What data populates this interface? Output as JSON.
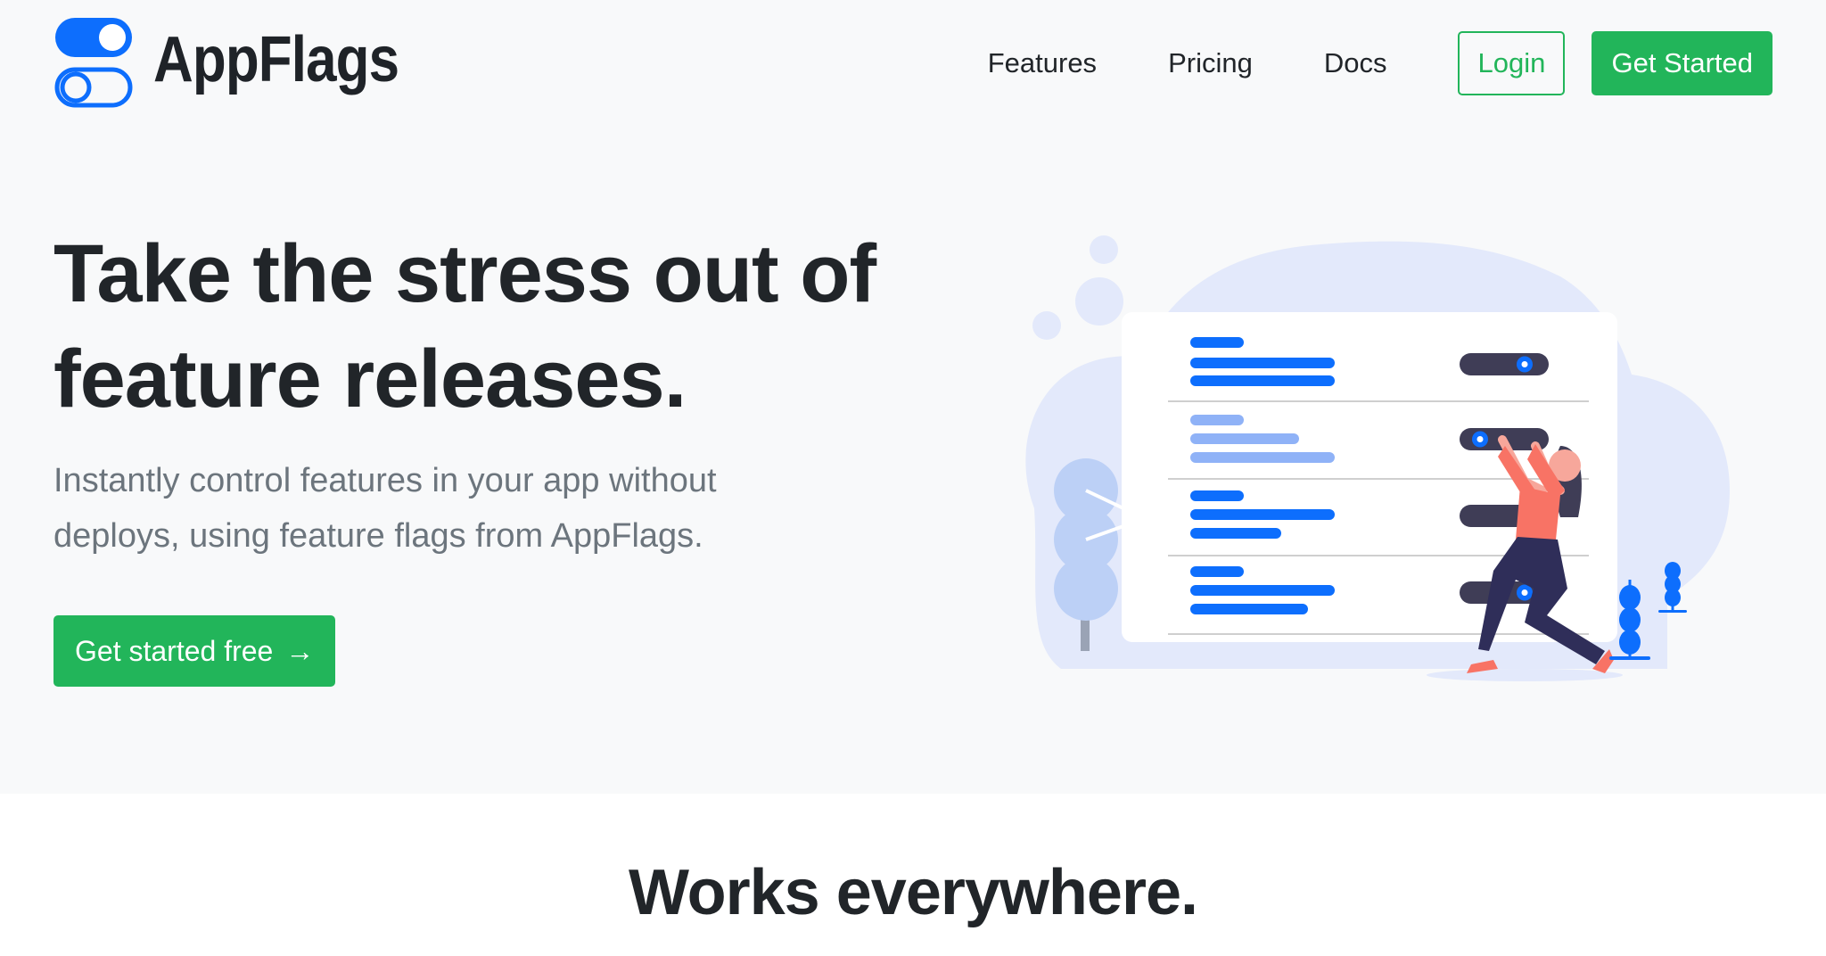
{
  "brand": {
    "name": "AppFlags",
    "logo_icon": "toggle-switches-icon",
    "accent_color": "#0d6efd"
  },
  "nav": {
    "links": [
      "Features",
      "Pricing",
      "Docs"
    ],
    "login_label": "Login",
    "get_started_label": "Get Started"
  },
  "hero": {
    "title_line1": "Take the stress out of",
    "title_line2": "feature releases.",
    "subtitle_line1": "Instantly control features in your app without",
    "subtitle_line2": "deploys, using feature flags from AppFlags.",
    "cta_label": "Get started free",
    "cta_icon": "arrow-right-icon",
    "illustration": "woman-toggling-feature-flags-illustration"
  },
  "section": {
    "heading": "Works everywhere."
  },
  "colors": {
    "primary_green": "#22b55a",
    "brand_blue": "#0d6efd",
    "hero_bg": "#f8f9fa",
    "text_dark": "#212529",
    "text_muted": "#6c757d"
  }
}
